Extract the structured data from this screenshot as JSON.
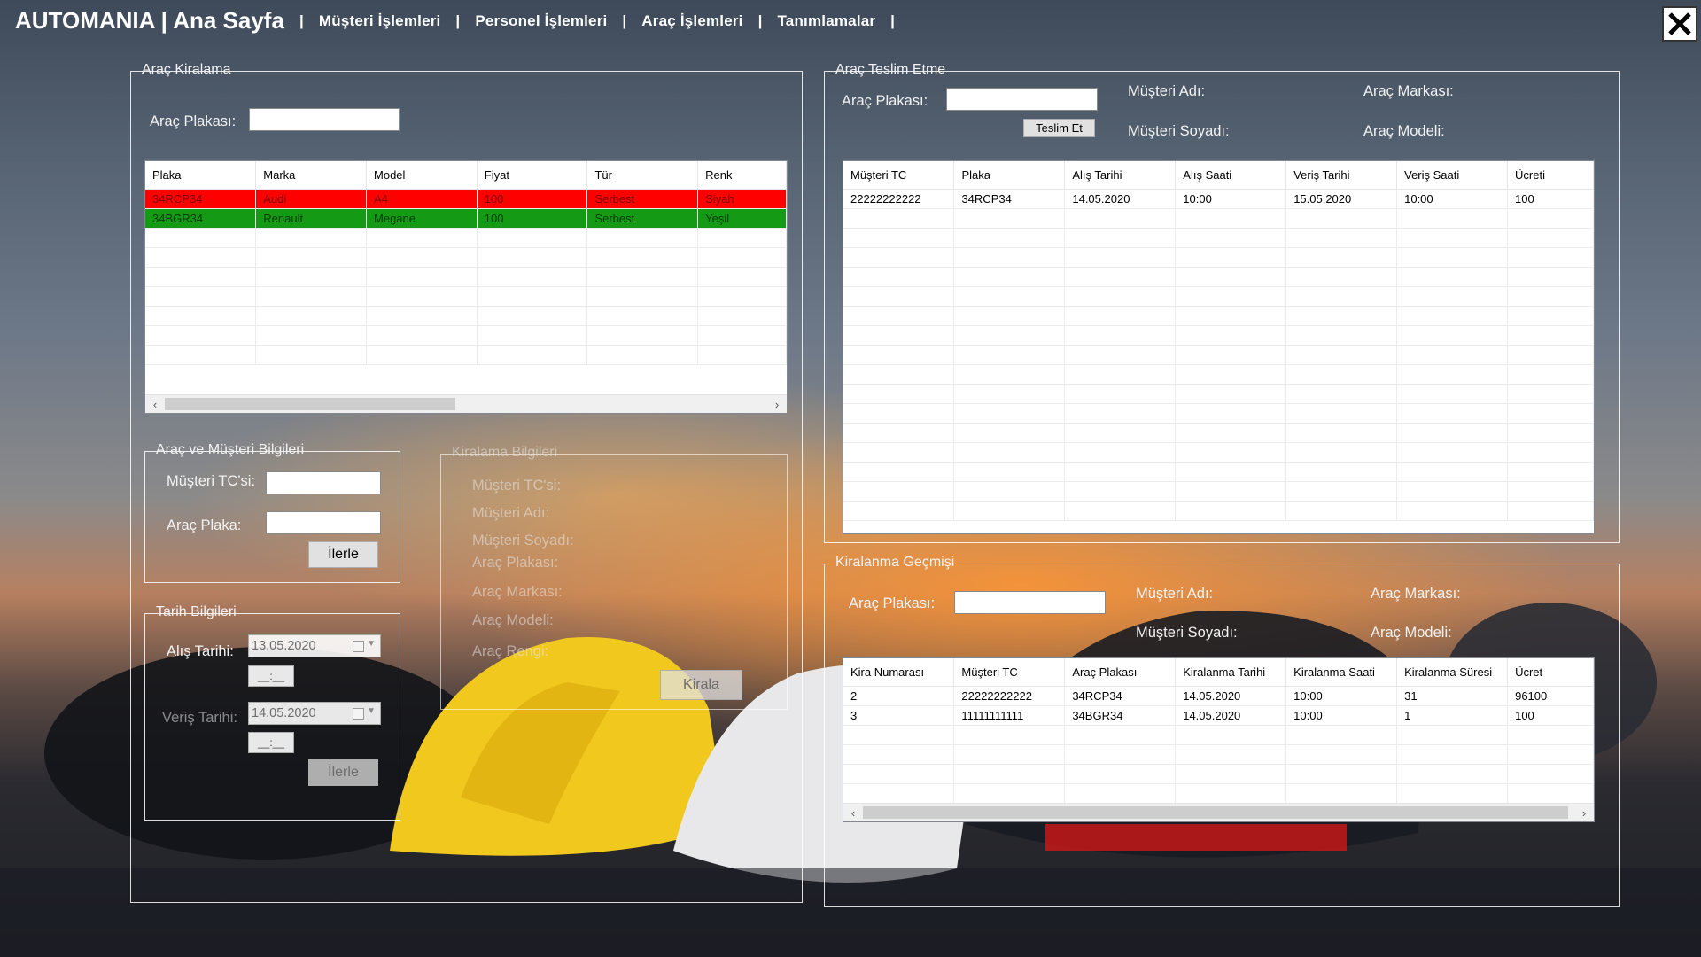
{
  "header": {
    "brand": "AUTOMANIA | Ana Sayfa",
    "sep_first": "|",
    "menu": [
      "Müşteri İşlemleri",
      "|",
      "Personel İşlemleri",
      "|",
      "Araç İşlemleri",
      "|",
      "Tanımlamalar",
      "|"
    ]
  },
  "icons": {
    "close": "close-x-icon",
    "calendar": "calendar-icon",
    "dropdown": "chevron-down-icon"
  },
  "colors": {
    "row_rented": "#ff0000",
    "row_available": "#149a14"
  },
  "rent": {
    "legend": "Araç Kiralama",
    "plate_label": "Araç Plakası:",
    "plate_value": "",
    "grid": {
      "columns": [
        "Plaka",
        "Marka",
        "Model",
        "Fiyat",
        "Tür",
        "Renk"
      ],
      "rows": [
        [
          "34RCP34",
          "Audi",
          "A4",
          "100",
          "Serbest",
          "Siyah"
        ],
        [
          "34BGR34",
          "Renault",
          "Megane",
          "100",
          "Serbest",
          "Yeşil"
        ]
      ]
    },
    "info": {
      "legend": "Araç ve Müşteri Bilgileri",
      "tc_label": "Müşteri TC'si:",
      "tc_value": "",
      "plate_label": "Araç Plaka:",
      "plate_value": "",
      "next_label": "İlerle"
    },
    "dates": {
      "legend": "Tarih Bilgileri",
      "pickup_label": "Alış Tarihi:",
      "pickup_date": "13.05.2020",
      "pickup_time": "__:__",
      "return_label": "Veriş Tarihi:",
      "return_date": "14.05.2020",
      "return_time": "__:__",
      "next_label": "İlerle"
    },
    "details": {
      "legend": "Kiralama Bilgileri",
      "labels": [
        "Müşteri TC'si:",
        "Müşteri Adı:",
        "Müşteri Soyadı:",
        "Araç Plakası:",
        "Araç Markası:",
        "Araç Modeli:",
        "Araç Rengi:"
      ],
      "rent_button": "Kirala"
    }
  },
  "delivery": {
    "legend": "Araç Teslim Etme",
    "plate_label": "Araç Plakası:",
    "plate_value": "",
    "deliver_button": "Teslim Et",
    "name_label": "Müşteri Adı:",
    "surname_label": "Müşteri Soyadı:",
    "brand_label": "Araç Markası:",
    "model_label": "Araç Modeli:",
    "grid": {
      "columns": [
        "Müşteri TC",
        "Plaka",
        "Alış Tarihi",
        "Alış Saati",
        "Veriş Tarihi",
        "Veriş Saati",
        "Ücreti"
      ],
      "rows": [
        [
          "22222222222",
          "34RCP34",
          "14.05.2020",
          "10:00",
          "15.05.2020",
          "10:00",
          "100"
        ]
      ]
    }
  },
  "history": {
    "legend": "Kiralanma Geçmişi",
    "plate_label": "Araç Plakası:",
    "plate_value": "",
    "name_label": "Müşteri Adı:",
    "surname_label": "Müşteri Soyadı:",
    "brand_label": "Araç Markası:",
    "model_label": "Araç Modeli:",
    "grid": {
      "columns": [
        "Kira Numarası",
        "Müşteri TC",
        "Araç Plakası",
        "Kiralanma Tarihi",
        "Kiralanma Saati",
        "Kiralanma Süresi",
        "Ücret"
      ],
      "rows": [
        [
          "2",
          "22222222222",
          "34RCP34",
          "14.05.2020",
          "10:00",
          "31",
          "96100"
        ],
        [
          "3",
          "11111111111",
          "34BGR34",
          "14.05.2020",
          "10:00",
          "1",
          "100"
        ]
      ]
    }
  }
}
